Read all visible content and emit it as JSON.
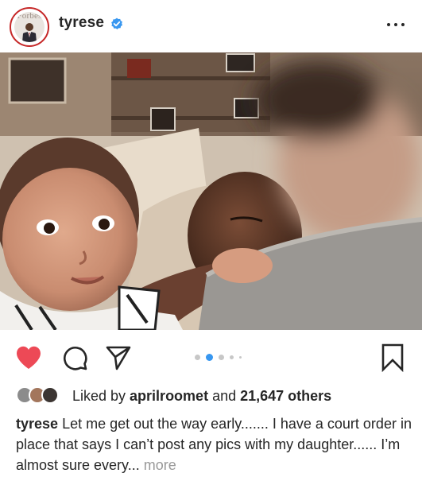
{
  "post": {
    "username": "tyrese",
    "verified": true,
    "avatar_logo_text": "Forbes",
    "more_options_icon": "ellipsis-icon"
  },
  "actions": {
    "like_icon": "heart-filled-icon",
    "like_color": "#ed4956",
    "comment_icon": "comment-bubble-icon",
    "share_icon": "paper-plane-icon",
    "save_icon": "bookmark-icon",
    "carousel": {
      "total": 5,
      "active_index": 1
    }
  },
  "likes": {
    "prefix": "Liked by ",
    "liked_by_user": "aprilroomet",
    "connector": " and ",
    "others_count": "21,647 others"
  },
  "caption": {
    "username": "tyrese",
    "text": "Let me get out the way early....... I have a court order in place that says I can’t post any pics with my daughter...... I’m almost sure every...",
    "more_label": "more"
  },
  "colors": {
    "accent_red": "#ed4956",
    "verified_blue": "#3897f0",
    "text": "#262626",
    "muted": "#999999"
  }
}
